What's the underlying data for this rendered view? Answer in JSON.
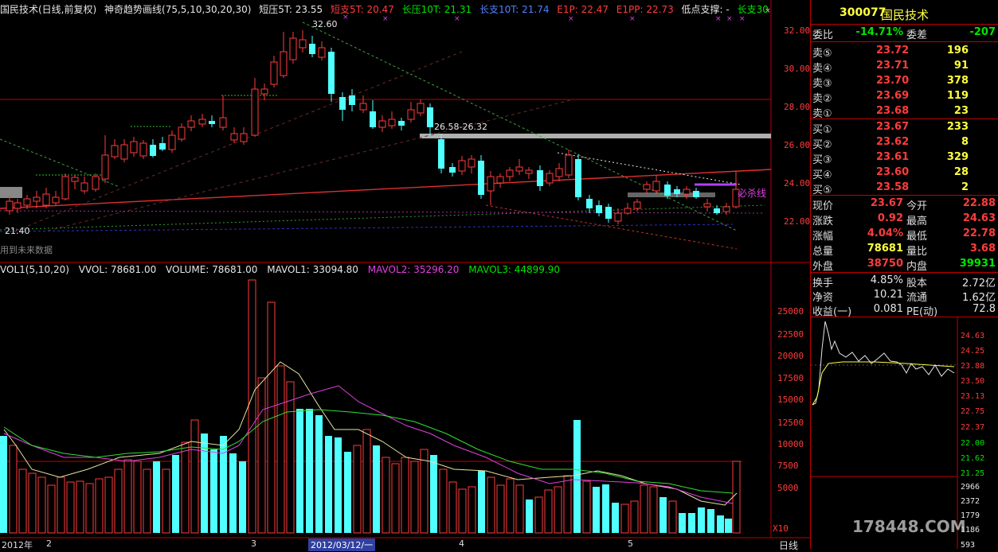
{
  "header": {
    "title": "国民技术(日线,前复权)",
    "indicator": "神奇趋势画线(75,5,10,30,20,30)",
    "items": [
      {
        "label": "短压5T: 23.55",
        "color": "#e6e6e6"
      },
      {
        "label": "短支5T: 20.47",
        "color": "#ff3c3c"
      },
      {
        "label": "长压10T: 21.31",
        "color": "#00e600"
      },
      {
        "label": "长支10T: 21.74",
        "color": "#5080ff"
      },
      {
        "label": "E1P: 22.47",
        "color": "#ff3c3c"
      },
      {
        "label": "E1PP: 22.73",
        "color": "#ff3c3c"
      },
      {
        "label": "低点支撑: -",
        "color": "#e6e6e6"
      },
      {
        "label": "长支30",
        "color": "#00e600"
      }
    ]
  },
  "price_chart": {
    "y_ticks": [
      "32.00",
      "30.00",
      "28.00",
      "26.00",
      "24.00",
      "22.00"
    ],
    "annotations": {
      "high": "32.60",
      "low": "21.40",
      "range": "26.58-26.32",
      "bisha": "必杀线",
      "future": "用到未来数据"
    }
  },
  "volume": {
    "header": [
      {
        "label": "VOL1(5,10,20)",
        "color": "#e6e6e6"
      },
      {
        "label": "VVOL: 78681.00",
        "color": "#e6e6e6"
      },
      {
        "label": "VOLUME: 78681.00",
        "color": "#e6e6e6"
      },
      {
        "label": "MAVOL1: 33094.80",
        "color": "#e6e6e6"
      },
      {
        "label": "MAVOL2: 35296.20",
        "color": "#e040e0"
      },
      {
        "label": "MAVOL3: 44899.90",
        "color": "#00e600"
      }
    ],
    "y_ticks": [
      "25000",
      "22500",
      "20000",
      "17500",
      "15000",
      "12500",
      "10000",
      "7500",
      "5000"
    ],
    "multiplier": "X10"
  },
  "dates": {
    "year": "2012年",
    "m2": "2",
    "m3": "3",
    "cursor_date": "2012/03/12/一",
    "m4": "4",
    "m5": "5",
    "period": "日线"
  },
  "quote": {
    "code": "300077",
    "name": "国民技术",
    "weibi_label": "委比",
    "weibi": "-14.71%",
    "weicha_label": "委差",
    "weicha": "-207",
    "asks": [
      {
        "label": "卖⑤",
        "price": "23.72",
        "vol": "196"
      },
      {
        "label": "卖④",
        "price": "23.71",
        "vol": "91"
      },
      {
        "label": "卖③",
        "price": "23.70",
        "vol": "378"
      },
      {
        "label": "卖②",
        "price": "23.69",
        "vol": "119"
      },
      {
        "label": "卖①",
        "price": "23.68",
        "vol": "23"
      }
    ],
    "bids": [
      {
        "label": "买①",
        "price": "23.67",
        "vol": "233"
      },
      {
        "label": "买②",
        "price": "23.62",
        "vol": "8"
      },
      {
        "label": "买③",
        "price": "23.61",
        "vol": "329"
      },
      {
        "label": "买④",
        "price": "23.60",
        "vol": "28"
      },
      {
        "label": "买⑤",
        "price": "23.58",
        "vol": "2"
      }
    ],
    "stats": [
      {
        "k1": "现价",
        "v1": "23.67",
        "c1": "#ff3c3c",
        "k2": "今开",
        "v2": "22.88",
        "c2": "#ff3c3c"
      },
      {
        "k1": "涨跌",
        "v1": "0.92",
        "c1": "#ff3c3c",
        "k2": "最高",
        "v2": "24.63",
        "c2": "#ff3c3c"
      },
      {
        "k1": "涨幅",
        "v1": "4.04%",
        "c1": "#ff3c3c",
        "k2": "最低",
        "v2": "22.78",
        "c2": "#ff3c3c"
      },
      {
        "k1": "总量",
        "v1": "78681",
        "c1": "#ffff40",
        "k2": "量比",
        "v2": "3.68",
        "c2": "#ff3c3c"
      },
      {
        "k1": "外盘",
        "v1": "38750",
        "c1": "#ff3c3c",
        "k2": "内盘",
        "v2": "39931",
        "c2": "#00e600"
      }
    ],
    "fund": [
      {
        "k1": "换手",
        "v1": "4.85%",
        "k2": "股本",
        "v2": "2.72亿"
      },
      {
        "k1": "净资",
        "v1": "10.21",
        "k2": "流通",
        "v2": "1.62亿"
      },
      {
        "k1": "收益(一)",
        "v1": "0.081",
        "k2": "PE(动)",
        "v2": "72.8"
      }
    ]
  },
  "intraday": {
    "y_ticks": [
      "24.63",
      "24.25",
      "23.88",
      "23.50",
      "23.13",
      "22.75",
      "22.37",
      "22.00",
      "21.62",
      "21.25",
      "2966",
      "2372",
      "1779",
      "1186",
      "593"
    ]
  },
  "watermark": "178448.COM"
}
